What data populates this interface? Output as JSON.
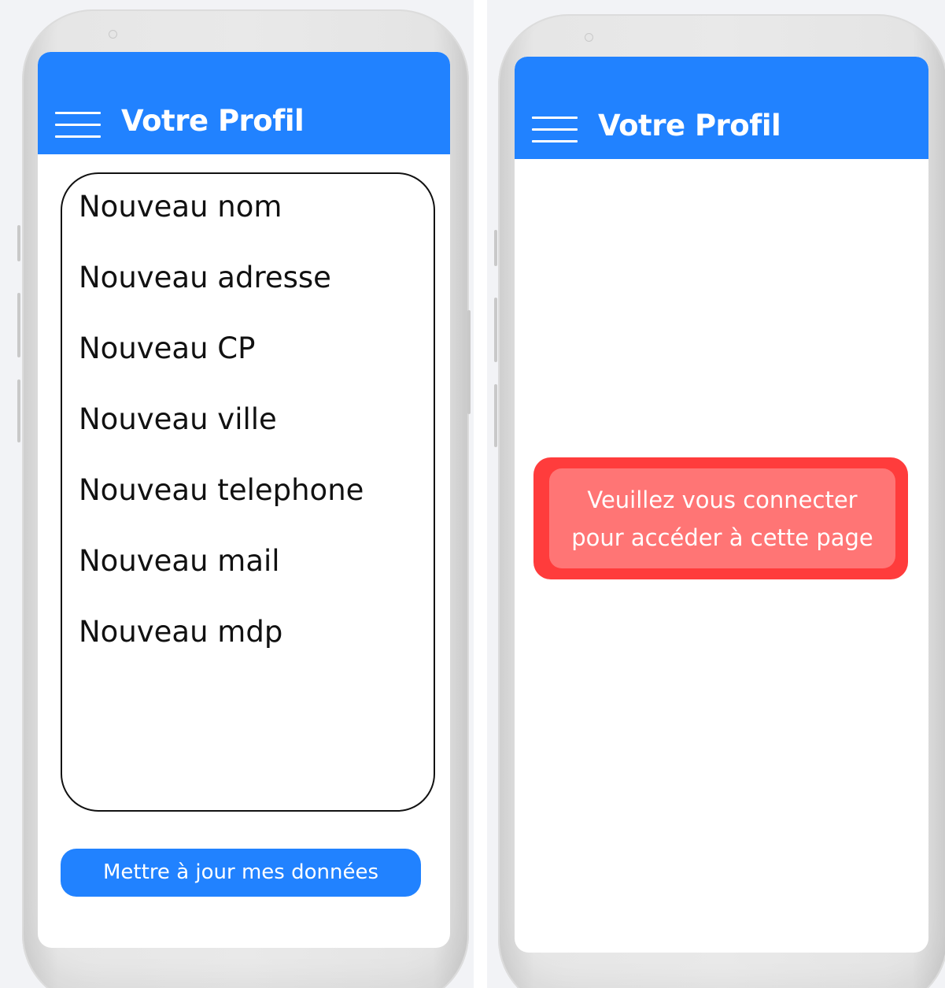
{
  "left_screen": {
    "header": {
      "title": "Votre Profil",
      "menu_icon": "hamburger-menu-icon"
    },
    "form": {
      "fields": [
        "Nouveau nom",
        "Nouveau adresse",
        "Nouveau CP",
        "Nouveau ville",
        "Nouveau telephone",
        "Nouveau mail",
        "Nouveau mdp"
      ]
    },
    "update_button_label": "Mettre à jour mes données"
  },
  "right_screen": {
    "header": {
      "title": "Votre Profil",
      "menu_icon": "hamburger-menu-icon"
    },
    "alert": {
      "line1": "Veuillez vous connecter",
      "line2": "pour accéder à cette page"
    }
  },
  "colors": {
    "primary": "#2182ff",
    "alert_outer": "#ff3c3c",
    "alert_inner": "#ff7575"
  }
}
